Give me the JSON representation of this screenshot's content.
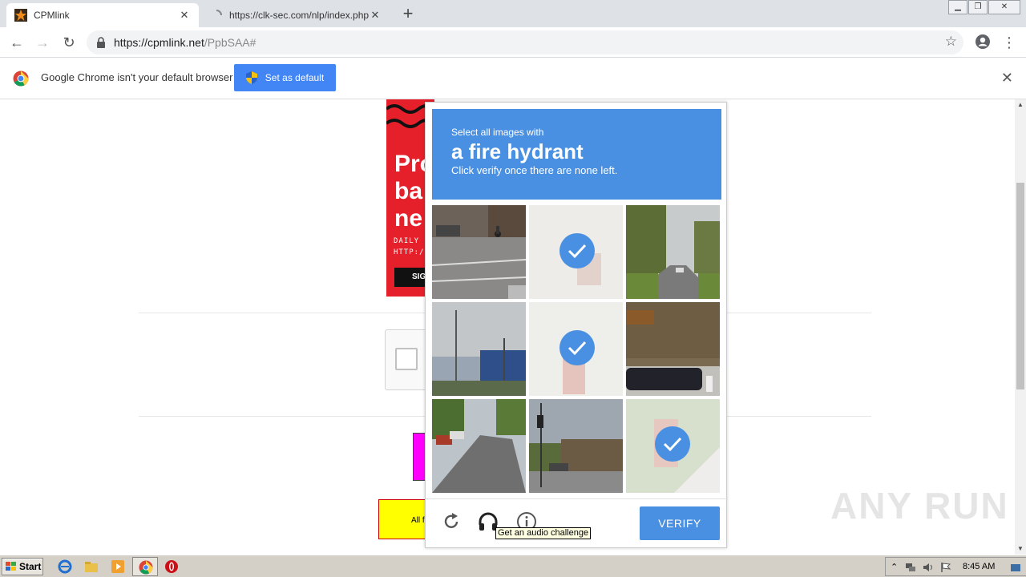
{
  "browser": {
    "tabs": [
      {
        "title": "CPMlink",
        "close": "✕"
      },
      {
        "title": "https://clk-sec.com/nlp/index.php?a",
        "close": "✕"
      }
    ],
    "new_tab": "+",
    "address": {
      "host": "https://cpmlink.net",
      "path": "/PpbSAA#"
    }
  },
  "infobar": {
    "message": "Google Chrome isn't your default browser",
    "button": "Set as default",
    "close": "✕"
  },
  "page": {
    "ad_text": [
      "Pro",
      "ba",
      "ne"
    ],
    "ad_small": [
      "DAILY N",
      "HTTP:/"
    ],
    "ad_button": "SIG",
    "yellow_text": "All f"
  },
  "captcha": {
    "instruction_line1": "Select all images with",
    "target": "a fire hydrant",
    "instruction_line3": "Click verify once there are none left.",
    "verify_label": "VERIFY",
    "tooltip": "Get an audio challenge",
    "selected_tiles": [
      1,
      4,
      8
    ]
  },
  "watermark": "ANY RUN",
  "taskbar": {
    "start": "Start",
    "clock": "8:45 AM"
  },
  "colors": {
    "accent": "#4a90e2",
    "chrome_blue": "#4285f4",
    "ad_red": "#e5202b"
  }
}
